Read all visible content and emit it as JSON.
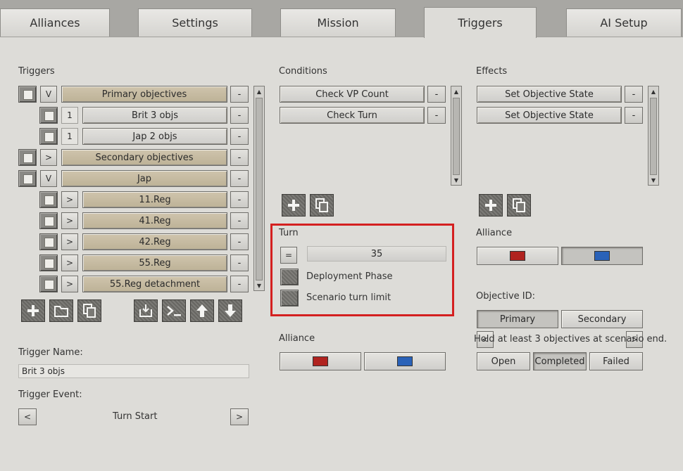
{
  "tabs": [
    {
      "label": "Alliances"
    },
    {
      "label": "Settings"
    },
    {
      "label": "Mission"
    },
    {
      "label": "Triggers"
    },
    {
      "label": "AI Setup"
    }
  ],
  "triggers": {
    "title": "Triggers",
    "items": [
      {
        "toggle": "V",
        "label": "Primary objectives",
        "minus": "-"
      },
      {
        "toggle": "1",
        "label": "Brit 3 objs",
        "minus": "-"
      },
      {
        "toggle": "1",
        "label": "Jap 2 objs",
        "minus": "-"
      },
      {
        "toggle": ">",
        "label": "Secondary objectives",
        "minus": "-"
      },
      {
        "toggle": "V",
        "label": "Jap",
        "minus": "-"
      },
      {
        "toggle": ">",
        "label": "11.Reg",
        "minus": "-"
      },
      {
        "toggle": ">",
        "label": "41.Reg",
        "minus": "-"
      },
      {
        "toggle": ">",
        "label": "42.Reg",
        "minus": "-"
      },
      {
        "toggle": ">",
        "label": "55.Reg",
        "minus": "-"
      },
      {
        "toggle": ">",
        "label": "55.Reg detachment",
        "minus": "-"
      }
    ],
    "name_label": "Trigger Name:",
    "name_value": "Brit 3 objs",
    "event_label": "Trigger Event:",
    "event_value": "Turn Start",
    "event_prev": "<",
    "event_next": ">"
  },
  "conditions": {
    "title": "Conditions",
    "items": [
      {
        "label": "Check VP Count",
        "minus": "-"
      },
      {
        "label": "Check Turn",
        "minus": "-"
      }
    ]
  },
  "turn": {
    "title": "Turn",
    "operator": "=",
    "value": "35",
    "deployment_label": "Deployment Phase",
    "limit_label": "Scenario turn limit"
  },
  "condition_alliance": {
    "title": "Alliance"
  },
  "effects": {
    "title": "Effects",
    "items": [
      {
        "label": "Set Objective State",
        "minus": "-"
      },
      {
        "label": "Set Objective State",
        "minus": "-"
      }
    ]
  },
  "effect_alliance": {
    "title": "Alliance"
  },
  "objective": {
    "title": "Objective ID:",
    "primary": "Primary",
    "secondary": "Secondary",
    "description": "Hold at least 3 objectives at scenario end.",
    "prev": "<",
    "next": ">",
    "states": [
      "Open",
      "Completed",
      "Failed"
    ]
  },
  "colors": {
    "red": "#b0231f",
    "blue": "#2a62b8",
    "highlight": "#d42020",
    "tan": "#c6bba1"
  }
}
